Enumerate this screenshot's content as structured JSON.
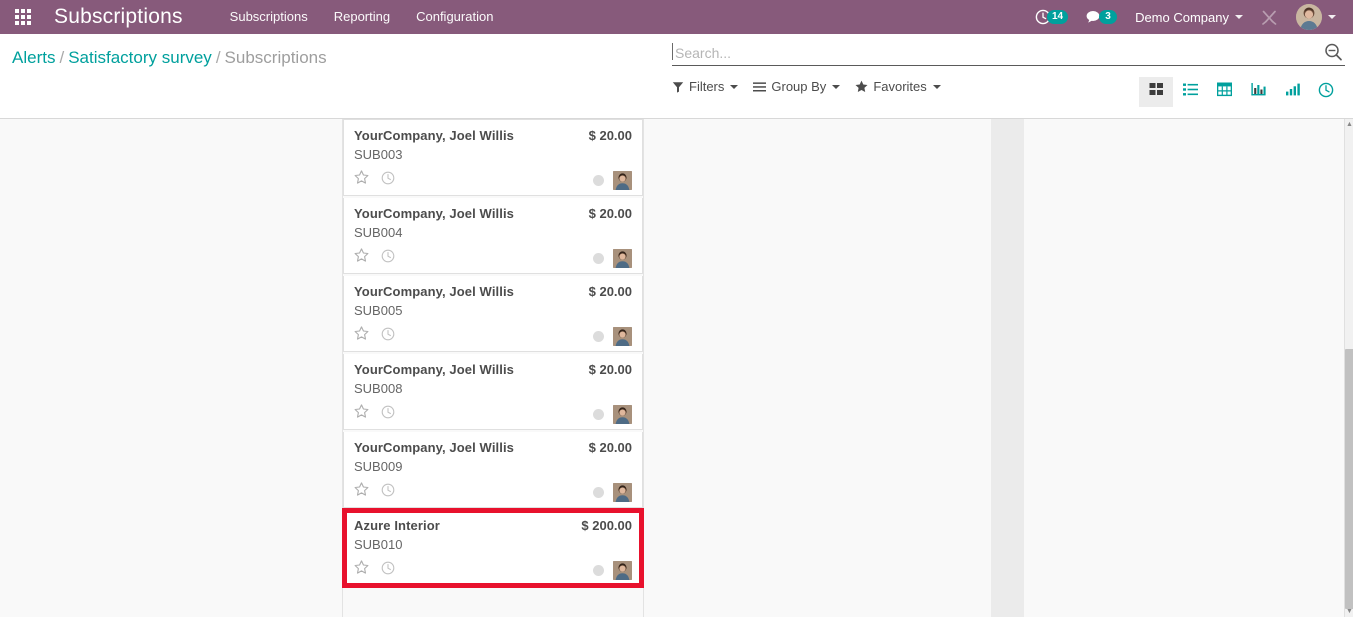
{
  "navbar": {
    "apps_icon": "apps-grid-icon",
    "brand": "Subscriptions",
    "menu": [
      {
        "label": "Subscriptions"
      },
      {
        "label": "Reporting"
      },
      {
        "label": "Configuration"
      }
    ],
    "activities": {
      "icon": "clock-icon",
      "count": "14"
    },
    "messages": {
      "icon": "chat-bubble-icon",
      "count": "3"
    },
    "company": "Demo Company",
    "debug_icon": "tools-icon",
    "user_avatar": "user-avatar",
    "background_color": "#875a7b",
    "badge_color": "#00a09d"
  },
  "breadcrumb": {
    "items": [
      {
        "label": "Alerts",
        "link": true
      },
      {
        "label": "Satisfactory survey",
        "link": true
      },
      {
        "label": "Subscriptions",
        "link": false
      }
    ],
    "separator": "/",
    "link_color": "#00a09d"
  },
  "search": {
    "placeholder": "Search...",
    "value": "",
    "search_icon": "magnifier-icon"
  },
  "filters": [
    {
      "label": "Filters",
      "icon": "filter-icon"
    },
    {
      "label": "Group By",
      "icon": "hamburger-icon"
    },
    {
      "label": "Favorites",
      "icon": "star-icon"
    }
  ],
  "view_switcher": [
    {
      "name": "kanban",
      "icon": "kanban-icon",
      "active": true
    },
    {
      "name": "list",
      "icon": "list-icon",
      "active": false
    },
    {
      "name": "pivot",
      "icon": "pivot-grid-icon",
      "active": false
    },
    {
      "name": "graph",
      "icon": "bar-chart-icon",
      "active": false
    },
    {
      "name": "dashboard",
      "icon": "ascending-bars-icon",
      "active": false
    },
    {
      "name": "cohort",
      "icon": "clock-icon",
      "active": false
    }
  ],
  "kanban": {
    "cards": [
      {
        "title": "YourCompany, Joel Willis",
        "price": "$ 20.00",
        "reference": "SUB003",
        "star_icon": "star-outline-icon",
        "clock_icon": "clock-outline-icon",
        "status": "grey",
        "avatar": "assignee-avatar"
      },
      {
        "title": "YourCompany, Joel Willis",
        "price": "$ 20.00",
        "reference": "SUB004",
        "star_icon": "star-outline-icon",
        "clock_icon": "clock-outline-icon",
        "status": "grey",
        "avatar": "assignee-avatar"
      },
      {
        "title": "YourCompany, Joel Willis",
        "price": "$ 20.00",
        "reference": "SUB005",
        "star_icon": "star-outline-icon",
        "clock_icon": "clock-outline-icon",
        "status": "grey",
        "avatar": "assignee-avatar"
      },
      {
        "title": "YourCompany, Joel Willis",
        "price": "$ 20.00",
        "reference": "SUB008",
        "star_icon": "star-outline-icon",
        "clock_icon": "clock-outline-icon",
        "status": "grey",
        "avatar": "assignee-avatar"
      },
      {
        "title": "YourCompany, Joel Willis",
        "price": "$ 20.00",
        "reference": "SUB009",
        "star_icon": "star-outline-icon",
        "clock_icon": "clock-outline-icon",
        "status": "grey",
        "avatar": "assignee-avatar"
      },
      {
        "title": "Azure Interior",
        "price": "$ 200.00",
        "reference": "SUB010",
        "star_icon": "star-outline-icon",
        "clock_icon": "clock-outline-icon",
        "status": "grey",
        "avatar": "assignee-avatar",
        "highlighted": true
      }
    ],
    "highlight_color": "#e8112d"
  }
}
